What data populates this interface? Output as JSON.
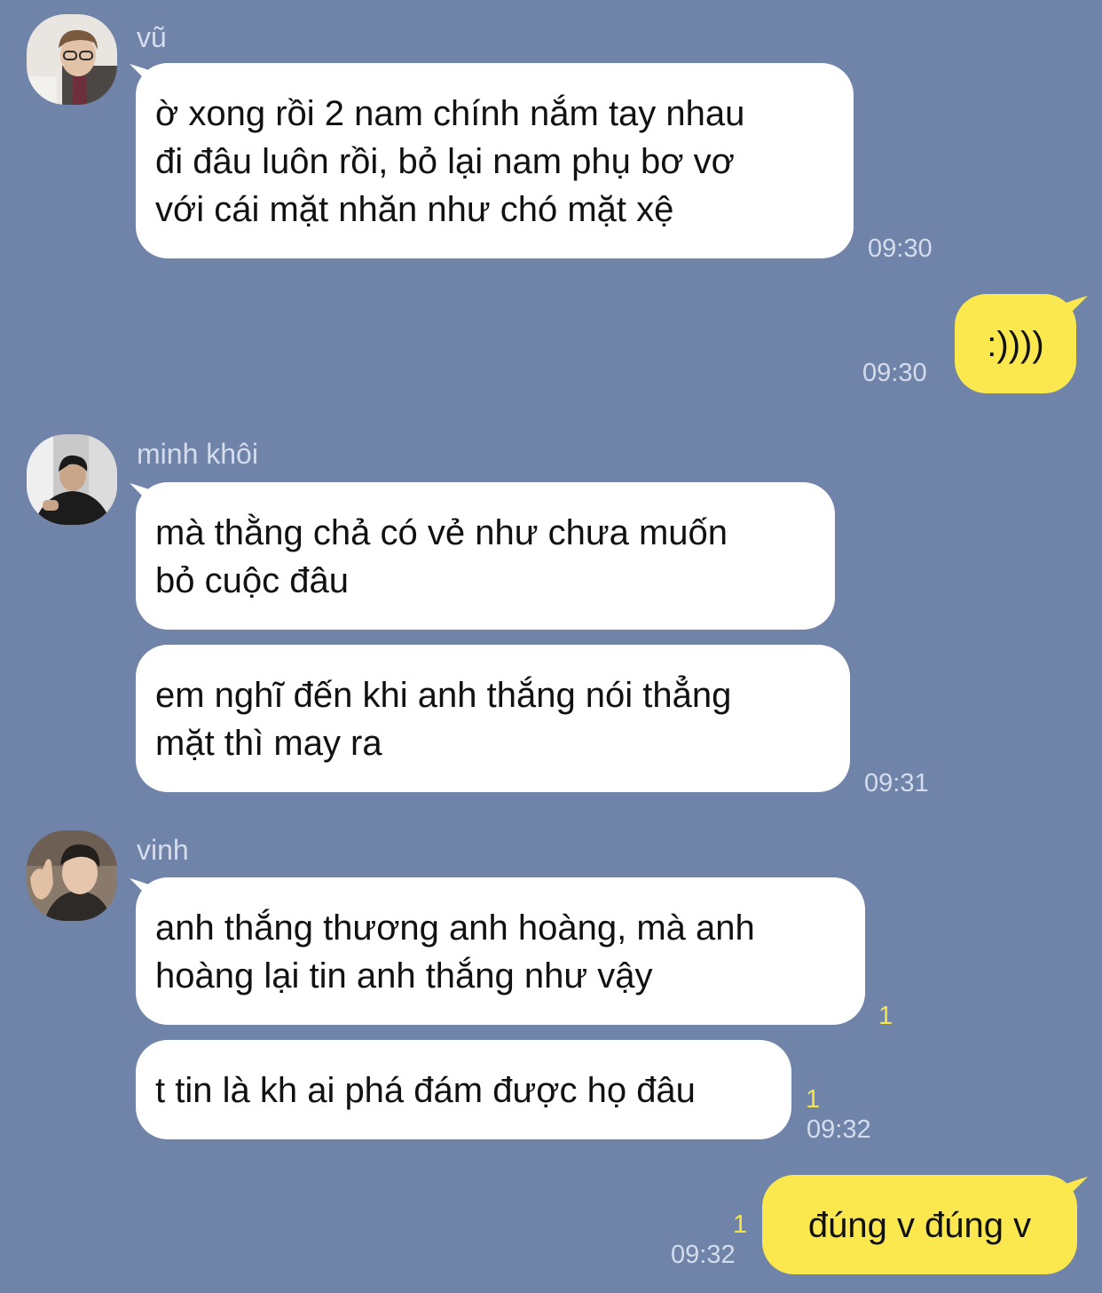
{
  "messages": [
    {
      "sender": "vũ",
      "avatar": "avatar-vu",
      "text": "ờ xong rồi 2 nam chính nắm tay nhau\nđi đâu luôn rồi, bỏ lại nam phụ bơ vơ\nvới cái mặt nhăn như chó mặt xệ",
      "time": "09:30"
    },
    {
      "mine": true,
      "text": ":))))",
      "time": "09:30"
    },
    {
      "sender": "minh khôi",
      "avatar": "avatar-minh-khoi",
      "text": "mà thằng chả có vẻ như chưa muốn\nbỏ cuộc đâu"
    },
    {
      "text": "em nghĩ đến khi anh thắng nói thẳng\nmặt thì may ra",
      "time": "09:31"
    },
    {
      "sender": "vinh",
      "avatar": "avatar-vinh",
      "text": "anh thắng thương anh hoàng, mà anh\nhoàng lại tin anh thắng như vậy",
      "unread": "1"
    },
    {
      "text": "t tin là kh ai phá đám được họ đâu",
      "unread": "1",
      "time": "09:32"
    },
    {
      "mine": true,
      "text": "đúng v đúng v",
      "unread": "1",
      "time": "09:32"
    }
  ],
  "colors": {
    "background": "#6f84a8",
    "incoming_bubble": "#ffffff",
    "outgoing_bubble": "#fbe84e",
    "unread_count": "#f6e44a",
    "meta_text": "#d4dced"
  }
}
